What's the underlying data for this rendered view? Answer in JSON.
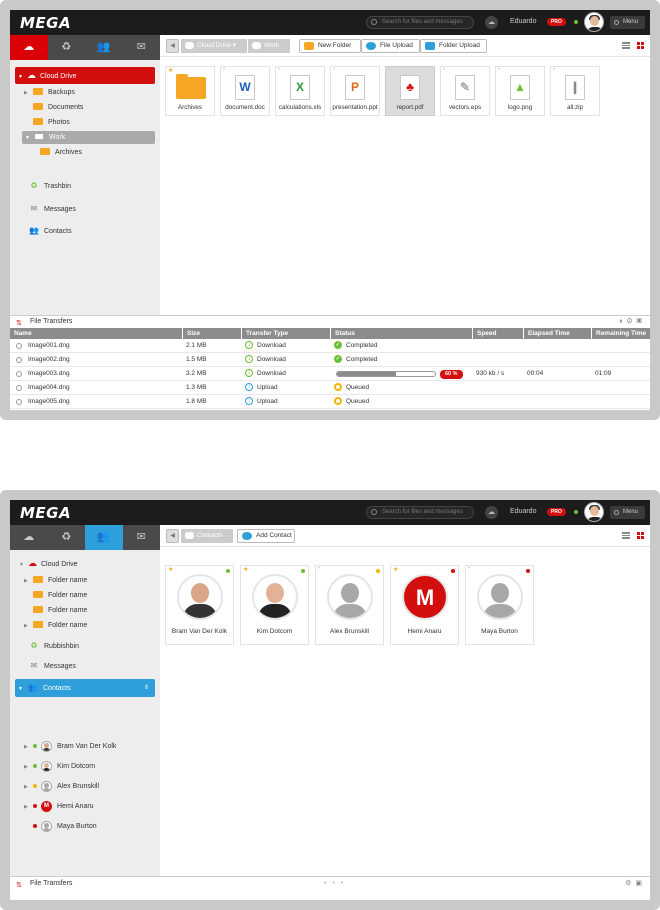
{
  "colors": {
    "brand_red": "#d90007",
    "accent_blue": "#2f9fdb",
    "online_green": "#6dbe34",
    "away_yellow": "#f5b400",
    "busy_red": "#d30e0e",
    "folder_orange": "#f5a623"
  },
  "topbar": {
    "logo": "MEGA",
    "search_placeholder": "Search for files and messages",
    "username": "Eduardo",
    "badge": "PRO",
    "menu_label": "Menu"
  },
  "screen1": {
    "tabs": [
      "cloud-icon",
      "trash-icon",
      "contacts-icon",
      "messages-icon"
    ],
    "tree": {
      "cloud_drive": "Cloud Drive",
      "backups": "Backups",
      "documents": "Documents",
      "photos": "Photos",
      "work": "Work",
      "archives": "Archives"
    },
    "side": {
      "trashbin": "Trashbin",
      "messages": "Messages",
      "contacts": "Contacts"
    },
    "breadcrumb": {
      "root": "Cloud Drive",
      "current": "Work"
    },
    "buttons": {
      "new_folder": "New Folder",
      "file_upload": "File Upload",
      "folder_upload": "Folder Upload"
    },
    "files": [
      {
        "name": "Archives",
        "glyph": "",
        "type": "folder"
      },
      {
        "name": "document.doc",
        "glyph": "W",
        "type": "doc"
      },
      {
        "name": "calculations.xls",
        "glyph": "X",
        "type": "xls"
      },
      {
        "name": "presentation.ppt",
        "glyph": "P",
        "type": "ppt"
      },
      {
        "name": "report.pdf",
        "glyph": "♣",
        "type": "pdf"
      },
      {
        "name": "vectors.eps",
        "glyph": "✎",
        "type": "eps"
      },
      {
        "name": "logo.png",
        "glyph": "▲",
        "type": "png"
      },
      {
        "name": "all.zip",
        "glyph": "❙",
        "type": "zip"
      }
    ],
    "transfers": {
      "title": "File Transfers",
      "columns": [
        "Name",
        "Size",
        "Transfer Type",
        "Status",
        "Speed",
        "Elapsed Time",
        "Remaining Time"
      ],
      "rows": [
        {
          "name": "Image001.dng",
          "size": "2.1 MB",
          "type": "Download",
          "status": "Completed",
          "speed": "",
          "elapsed": "",
          "remaining": ""
        },
        {
          "name": "Image002.dng",
          "size": "1.5 MB",
          "type": "Download",
          "status": "Completed",
          "speed": "",
          "elapsed": "",
          "remaining": ""
        },
        {
          "name": "Image003.dng",
          "size": "3.2 MB",
          "type": "Download",
          "status": "",
          "progress": 0.6,
          "progress_label": "60 %",
          "speed": "930 kb / s",
          "elapsed": "00:04",
          "remaining": "01:09"
        },
        {
          "name": "Image004.dng",
          "size": "1.3 MB",
          "type": "Upload",
          "status": "Queued",
          "speed": "",
          "elapsed": "",
          "remaining": ""
        },
        {
          "name": "Image005.dng",
          "size": "1.8 MB",
          "type": "Upload",
          "status": "Queued",
          "speed": "",
          "elapsed": "",
          "remaining": ""
        }
      ]
    }
  },
  "screen2": {
    "tree": {
      "cloud_drive": "Cloud Drive",
      "folders": [
        "Folder name",
        "Folder name",
        "Folder name",
        "Folder name"
      ],
      "rubbishbin": "Rubbishbin",
      "messages": "Messages",
      "contacts": "Contacts"
    },
    "breadcrumb": {
      "current": "Contacts"
    },
    "add_contact": "Add Contact",
    "contacts": [
      {
        "name": "Bram Van Der Kolk",
        "status": "online",
        "starred": true
      },
      {
        "name": "Kim Dotcom",
        "status": "online",
        "starred": true
      },
      {
        "name": "Alex Brunskill",
        "status": "away",
        "starred": false
      },
      {
        "name": "Hemi Anaru",
        "status": "busy",
        "starred": true
      },
      {
        "name": "Maya Burton",
        "status": "busy",
        "starred": false
      }
    ],
    "footer": "File Transfers"
  }
}
